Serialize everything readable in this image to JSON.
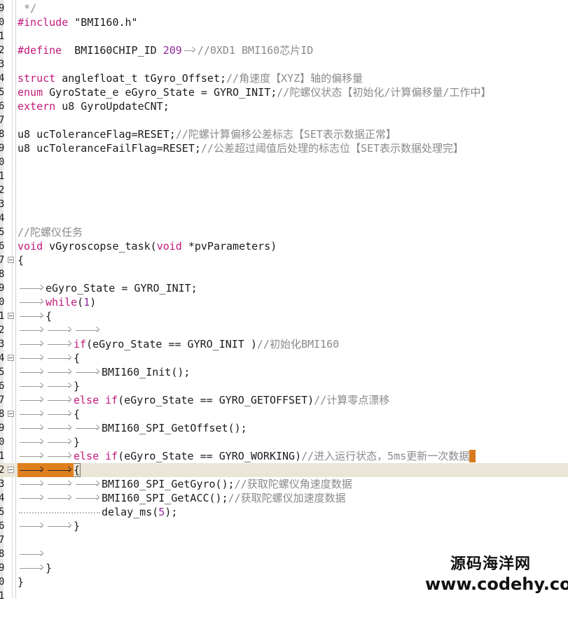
{
  "gutter": {
    "line_digits": [
      "9",
      "0",
      "1",
      "2",
      "3",
      "4",
      "5",
      "6",
      "7",
      "8",
      "9",
      "0",
      "1",
      "2",
      "3",
      "4",
      "5",
      "6",
      "7",
      "8",
      "9",
      "0",
      "1",
      "2",
      "3",
      "4",
      "5",
      "6",
      "7",
      "8",
      "9",
      "0",
      "1",
      "2",
      "3",
      "4",
      "5",
      "6",
      "7",
      "8",
      "9",
      "0",
      "1"
    ]
  },
  "code": {
    "l0": " */",
    "l1_pp": "#include",
    "l1_str": " \"BMI160.h\"",
    "l3_pp": "#define",
    "l3_name": "BMI160CHIP_ID",
    "l3_num": "209",
    "l3_cm": "//0XD1 BMI160芯片ID",
    "l5_kw": "struct",
    "l5_rest": " anglefloat_t tGyro_Offset;",
    "l5_cm": "//角速度【XYZ】轴的偏移量",
    "l6_kw": "enum",
    "l6_rest": " GyroState_e eGyro_State = GYRO_INIT;",
    "l6_cm": "//陀螺仪状态【初始化/计算偏移量/工作中】",
    "l7_kw": "extern",
    "l7_rest": " u8 GyroUpdateCNT;",
    "l9_rest": "u8 ucToleranceFlag=RESET;",
    "l9_cm": "//陀螺计算偏移公差标志【SET表示数据正常】",
    "l10_rest": "u8 ucToleranceFailFlag=RESET;",
    "l10_cm": "//公差超过阈值后处理的标志位【SET表示数据处理完】",
    "l16_cm": "//陀螺仪任务",
    "l17_kw1": "void",
    "l17_mid": " vGyroscopse_task(",
    "l17_kw2": "void",
    "l17_end": " *pvParameters)",
    "l18": "{",
    "l20": "eGyro_State = GYRO_INIT;",
    "l21_kw": "while",
    "l21_open": "(",
    "l21_num": "1",
    "l21_close": ")",
    "l22": "{",
    "l24_kw": "if",
    "l24_rest": "(eGyro_State == GYRO_INIT )",
    "l24_cm": "//初始化BMI160",
    "l25": "{",
    "l26": "BMI160_Init();",
    "l27": "}",
    "l28_kw": "else if",
    "l28_rest": "(eGyro_State == GYRO_GETOFFSET)",
    "l28_cm": "//计算零点漂移",
    "l29": "{",
    "l30": "BMI160_SPI_GetOffset();",
    "l31": "}",
    "l32_kw": "else if",
    "l32_rest": "(eGyro_State == GYRO_WORKING)",
    "l32_cm": "//进入运行状态，5ms更新一次数据",
    "l33": "{",
    "l34": "BMI160_SPI_GetGyro();",
    "l34_cm": "//获取陀螺仪角速度数据",
    "l35": "BMI160_SPI_GetACC();",
    "l35_cm": "//获取陀螺仪加速度数据",
    "l36_a": "delay_ms(",
    "l36_num": "5",
    "l36_b": ");",
    "l37": "}",
    "l40": "}",
    "l41": "}"
  },
  "watermark": {
    "title": "源码海洋网",
    "url": "www.codehy.com"
  },
  "colors": {
    "keyword": "#c2187a",
    "comment": "#8a8a8a",
    "number": "#8f2a9c",
    "current_line": "#eae5d7",
    "caret_marker": "#d67a1c"
  }
}
